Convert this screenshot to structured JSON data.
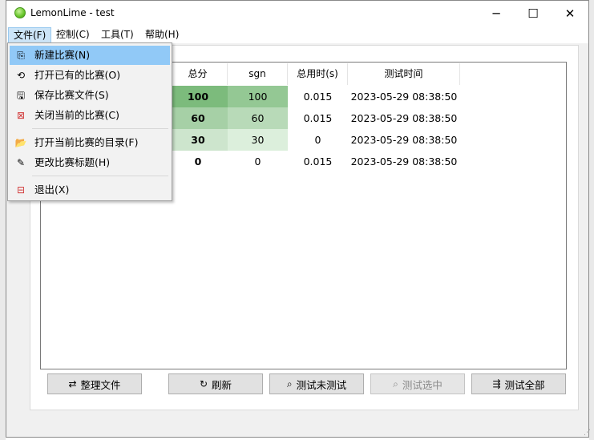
{
  "window": {
    "title": "LemonLime - test",
    "minimize_glyph": "─",
    "maximize_glyph": "☐",
    "close_glyph": "✕"
  },
  "menubar": {
    "items": [
      {
        "label": "文件(F)"
      },
      {
        "label": "控制(C)"
      },
      {
        "label": "工具(T)"
      },
      {
        "label": "帮助(H)"
      }
    ]
  },
  "file_menu": {
    "items": [
      {
        "label": "新建比赛(N)",
        "icon": "new-contest-icon",
        "glyph": "⎘"
      },
      {
        "label": "打开已有的比赛(O)",
        "icon": "open-contest-icon",
        "glyph": "⟲"
      },
      {
        "label": "保存比赛文件(S)",
        "icon": "save-icon",
        "glyph": "🖫"
      },
      {
        "label": "关闭当前的比赛(C)",
        "icon": "close-contest-icon",
        "glyph": "⊠"
      },
      {
        "label": "打开当前比赛的目录(F)",
        "icon": "open-folder-icon",
        "glyph": "📂"
      },
      {
        "label": "更改比赛标题(H)",
        "icon": "pencil-icon",
        "glyph": "✎"
      },
      {
        "label": "退出(X)",
        "icon": "exit-icon",
        "glyph": "⊟"
      }
    ]
  },
  "results_table": {
    "headers": [
      "总分",
      "sgn",
      "总用时(s)",
      "测试时间"
    ],
    "rows": [
      {
        "total": "100",
        "sgn": "100",
        "time": "0.015",
        "tested": "2023-05-29 08:38:50"
      },
      {
        "total": "60",
        "sgn": "60",
        "time": "0.015",
        "tested": "2023-05-29 08:38:50"
      },
      {
        "total": "30",
        "sgn": "30",
        "time": "0",
        "tested": "2023-05-29 08:38:50"
      },
      {
        "total": "0",
        "sgn": "0",
        "time": "0.015",
        "tested": "2023-05-29 08:38:50"
      }
    ],
    "score_colors": [
      "#7cbb7c",
      "#a6d0a6",
      "#cde5cd",
      "#ffffff"
    ],
    "sgn_colors": [
      "#94c894",
      "#b8dab8",
      "#dcefdc",
      "#ffffff"
    ]
  },
  "buttons": {
    "organize": "整理文件",
    "refresh": "刷新",
    "test_untested": "测试未测试",
    "test_selected": "测试选中",
    "test_all": "测试全部"
  }
}
